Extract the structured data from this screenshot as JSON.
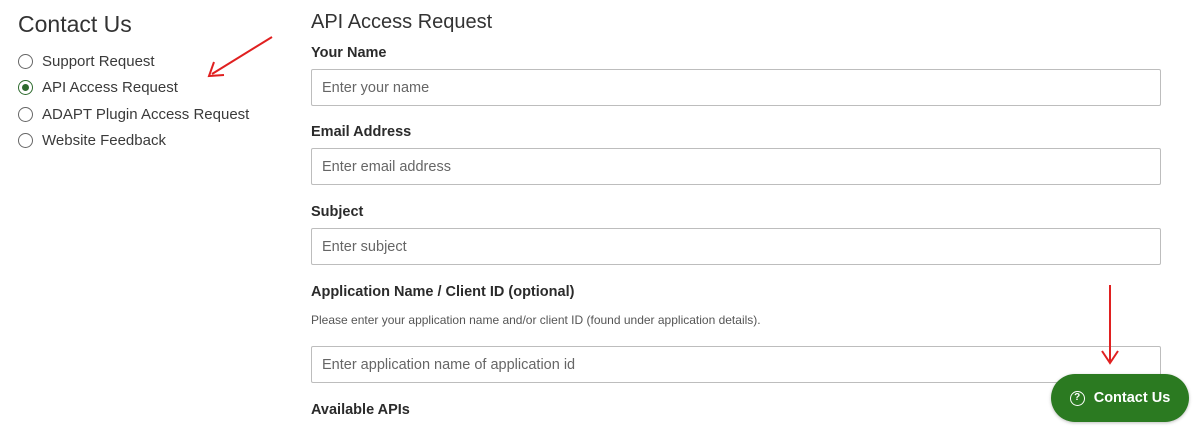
{
  "sidebar": {
    "title": "Contact Us",
    "options": [
      {
        "label": "Support Request",
        "checked": false
      },
      {
        "label": "API Access Request",
        "checked": true
      },
      {
        "label": "ADAPT Plugin Access Request",
        "checked": false
      },
      {
        "label": "Website Feedback",
        "checked": false
      }
    ]
  },
  "form": {
    "title": "API Access Request",
    "name": {
      "label": "Your Name",
      "placeholder": "Enter your name",
      "value": ""
    },
    "email": {
      "label": "Email Address",
      "placeholder": "Enter email address",
      "value": ""
    },
    "subject": {
      "label": "Subject",
      "placeholder": "Enter subject",
      "value": ""
    },
    "application": {
      "label": "Application Name / Client ID (optional)",
      "help": "Please enter your application name and/or client ID (found under application details).",
      "placeholder": "Enter application name of application id",
      "value": ""
    },
    "apis": {
      "label": "Available APIs"
    }
  },
  "contact_button": {
    "label": "Contact Us",
    "icon": "question-circle-icon"
  },
  "annotations": {
    "arrow_color": "#e02020"
  },
  "colors": {
    "brand_green": "#2b7a21",
    "radio_checked": "#2e6b2e"
  }
}
